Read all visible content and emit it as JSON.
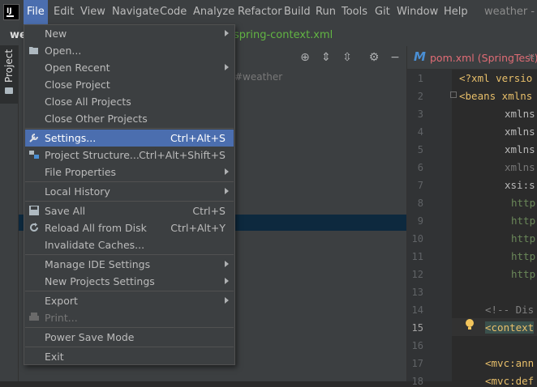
{
  "menubar": {
    "items": [
      "File",
      "Edit",
      "View",
      "Navigate",
      "Code",
      "Analyze",
      "Refactor",
      "Build",
      "Run",
      "Tools",
      "Git",
      "Window",
      "Help"
    ],
    "active": "File",
    "window_title": "weather - sp"
  },
  "tool_window": {
    "project_label": "Project"
  },
  "tabs": {
    "nav_crumb": "we",
    "context_file": "spring-context.xml"
  },
  "project_panel": {
    "hash_text": "#weather"
  },
  "editor": {
    "tab_icon": "M",
    "tab_name": "pom.xml (SpringTest)",
    "tab_close": "×",
    "line_numbers": [
      "1",
      "2",
      "3",
      "4",
      "5",
      "6",
      "7",
      "8",
      "9",
      "10",
      "11",
      "12",
      "13",
      "14",
      "15",
      "16",
      "17",
      "18"
    ],
    "current_line": "15",
    "lines": [
      "<?xml versio",
      "<beans xmlns",
      "xmlns",
      "xmlns",
      "xmlns",
      "xmlns",
      "xsi:s",
      "http",
      "http",
      "http",
      "http",
      "http",
      "",
      "<!-- Dis",
      "<context",
      "",
      "<mvc:ann",
      "<mvc:def"
    ]
  },
  "file_menu": {
    "items": [
      {
        "label": "New",
        "submenu": true
      },
      {
        "label": "Open...",
        "icon": "folder-open-icon"
      },
      {
        "label": "Open Recent",
        "submenu": true
      },
      {
        "label": "Close Project"
      },
      {
        "label": "Close All Projects"
      },
      {
        "label": "Close Other Projects"
      },
      {
        "label": "Settings...",
        "shortcut": "Ctrl+Alt+S",
        "icon": "wrench-icon",
        "highlighted": true
      },
      {
        "label": "Project Structure...",
        "shortcut": "Ctrl+Alt+Shift+S",
        "icon": "project-structure-icon"
      },
      {
        "label": "File Properties",
        "submenu": true
      },
      {
        "label": "Local History",
        "submenu": true
      },
      {
        "label": "Save All",
        "shortcut": "Ctrl+S",
        "icon": "save-icon"
      },
      {
        "label": "Reload All from Disk",
        "shortcut": "Ctrl+Alt+Y",
        "icon": "reload-icon"
      },
      {
        "label": "Invalidate Caches..."
      },
      {
        "label": "Manage IDE Settings",
        "submenu": true
      },
      {
        "label": "New Projects Settings",
        "submenu": true
      },
      {
        "label": "Export",
        "submenu": true
      },
      {
        "label": "Print...",
        "icon": "print-icon",
        "disabled": true
      },
      {
        "label": "Power Save Mode"
      },
      {
        "label": "Exit"
      }
    ]
  },
  "colors": {
    "accent": "#4b6eaf",
    "menu_bg": "#3c3f41",
    "editor_bg": "#2b2b2b",
    "string_green": "#6a8759",
    "tag_yellow": "#e8bf6a"
  }
}
